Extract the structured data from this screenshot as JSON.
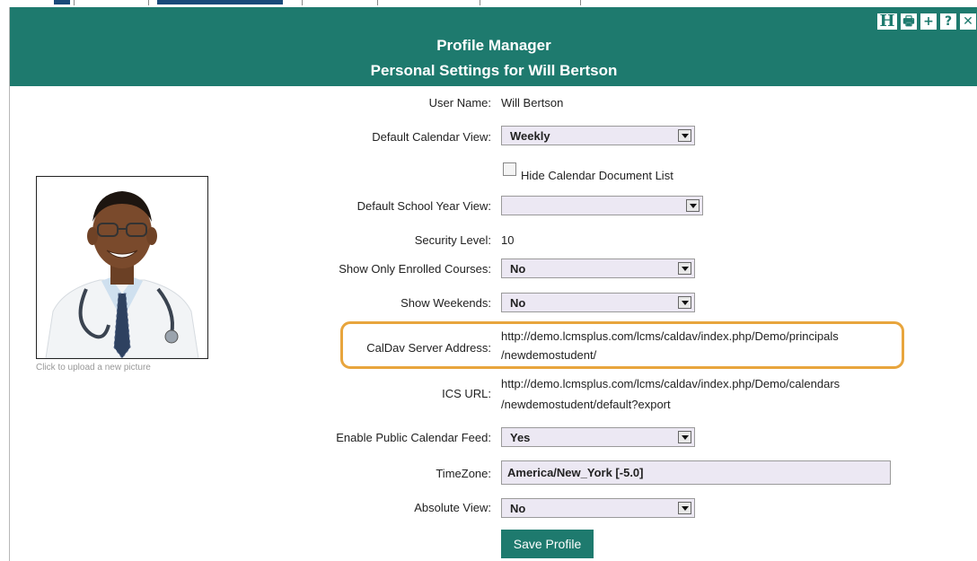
{
  "header": {
    "title": "Profile Manager",
    "subtitle": "Personal Settings for Will Bertson",
    "tools": [
      {
        "label": "H",
        "icon": "help-h-icon"
      },
      {
        "label": "🖶",
        "icon": "print-icon"
      },
      {
        "label": "+",
        "icon": "add-icon"
      },
      {
        "label": "?",
        "icon": "question-icon"
      },
      {
        "label": "✕",
        "icon": "close-icon"
      }
    ]
  },
  "photo": {
    "caption": "Click to upload a new picture"
  },
  "form": {
    "user_name": {
      "label": "User Name:",
      "value": "Will Bertson"
    },
    "default_calendar_view": {
      "label": "Default Calendar View:",
      "value": "Weekly"
    },
    "hide_calendar_doc_list": {
      "label": "Hide Calendar Document List",
      "checked": false
    },
    "default_school_year_view": {
      "label": "Default School Year View:",
      "value": ""
    },
    "security_level": {
      "label": "Security Level:",
      "value": "10"
    },
    "show_only_enrolled": {
      "label": "Show Only Enrolled Courses:",
      "value": "No"
    },
    "show_weekends": {
      "label": "Show Weekends:",
      "value": "No"
    },
    "caldav": {
      "label": "CalDav Server Address:",
      "line1": "http://demo.lcmsplus.com/lcms/caldav/index.php/Demo/principals",
      "line2": "/newdemostudent/"
    },
    "ics_url": {
      "label": "ICS URL:",
      "line1": "http://demo.lcmsplus.com/lcms/caldav/index.php/Demo/calendars",
      "line2": "/newdemostudent/default?export"
    },
    "public_feed": {
      "label": "Enable Public Calendar Feed:",
      "value": "Yes"
    },
    "timezone": {
      "label": "TimeZone:",
      "value": "America/New_York [-5.0]"
    },
    "absolute_view": {
      "label": "Absolute View:",
      "value": "No"
    },
    "save_label": "Save Profile"
  },
  "colors": {
    "header_bg": "#1e7a6e",
    "highlight": "#e8a53d",
    "input_bg": "#ece8f3"
  }
}
